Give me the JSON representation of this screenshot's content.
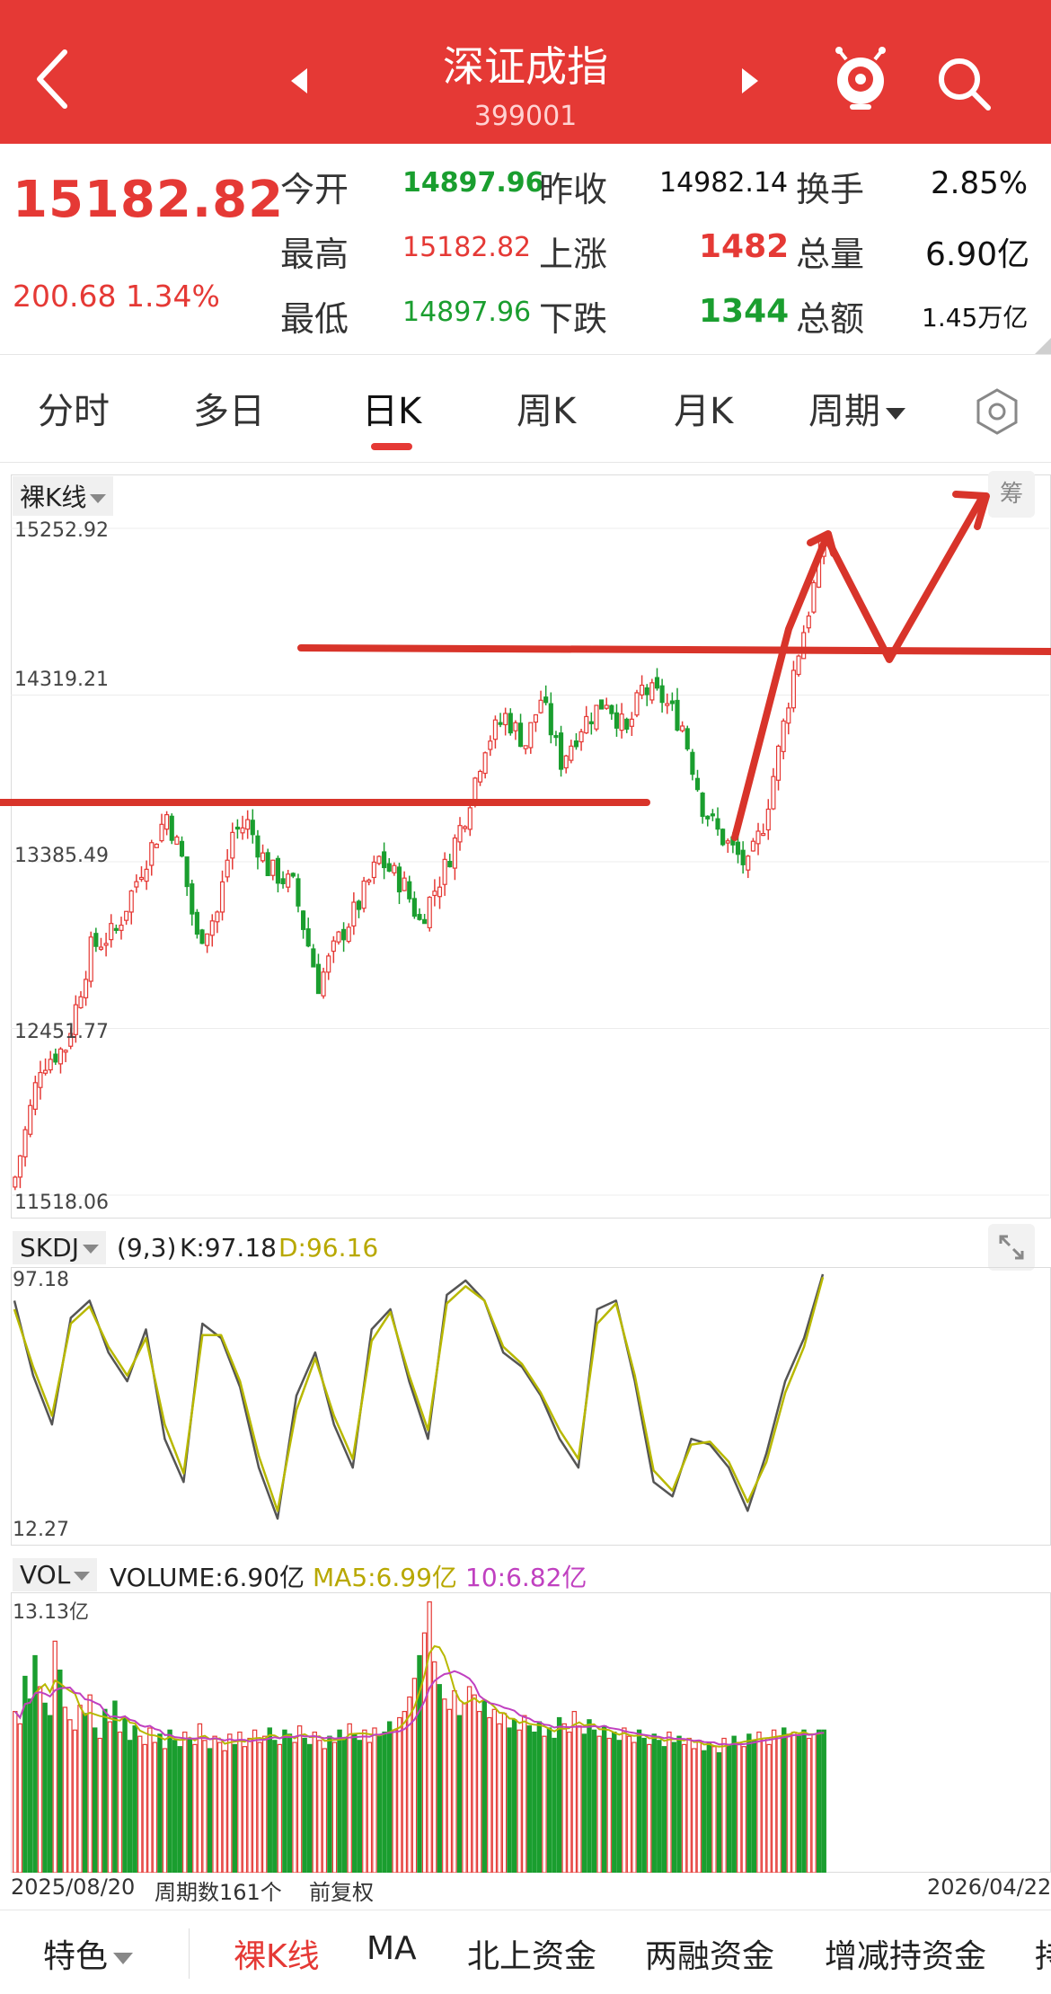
{
  "header": {
    "title": "深证成指",
    "code": "399001"
  },
  "quote": {
    "last_price": "15182.82",
    "change": "200.68",
    "change_pct": "1.34%",
    "fields": [
      {
        "label": "今开",
        "value": "14897.96",
        "color": "green"
      },
      {
        "label": "昨收",
        "value": "14982.14",
        "color": "dark"
      },
      {
        "label": "换手",
        "value": "2.85%",
        "color": "dark"
      },
      {
        "label": "最高",
        "value": "15182.82",
        "color": "red"
      },
      {
        "label": "上涨",
        "value": "1482",
        "color": "red"
      },
      {
        "label": "总量",
        "value": "6.90亿",
        "color": "dark"
      },
      {
        "label": "最低",
        "value": "14897.96",
        "color": "green"
      },
      {
        "label": "下跌",
        "value": "1344",
        "color": "green"
      },
      {
        "label": "总额",
        "value": "1.45万亿",
        "color": "dark"
      }
    ]
  },
  "tabs": [
    "分时",
    "多日",
    "日K",
    "周K",
    "月K",
    "周期"
  ],
  "active_tab": "日K",
  "kline": {
    "indicator": "裸K线",
    "chip_button": "筹",
    "price_labels": [
      "15252.92",
      "14319.21",
      "13385.49",
      "12451.77",
      "11518.06"
    ]
  },
  "skdj": {
    "indicator": "SKDJ",
    "params": "(9,3)",
    "k_text": "K:97.18",
    "d_text": "D:96.16",
    "top_label": "97.18",
    "bottom_label": "12.27"
  },
  "volume": {
    "indicator": "VOL",
    "volume_text": "VOLUME:6.90亿",
    "ma5_text": "MA5:6.99亿",
    "ma10_text": "10:6.82亿",
    "top_label": "13.13亿"
  },
  "dates": {
    "start": "2025/08/20",
    "period_count": "周期数161个",
    "adjust": "前复权",
    "end": "2026/04/22"
  },
  "bottom_tabs": [
    "特色",
    "裸K线",
    "MA",
    "北上资金",
    "两融资金",
    "增减持资金",
    "持"
  ],
  "colors": {
    "up": "#e53935",
    "down": "#1a9e2f",
    "header": "#e53935",
    "k_line": "#555555",
    "d_line": "#b8b800",
    "ma10": "#c040c0"
  },
  "chart_data": [
    {
      "type": "candlestick",
      "title": "",
      "ylim": [
        11518.06,
        15252.92
      ],
      "y_ticks": [
        15252.92,
        14319.21,
        13385.49,
        12451.77,
        11518.06
      ],
      "periods": 161,
      "x_range": [
        "2025/08/20",
        "2026/04/22"
      ],
      "close_path": [
        [
          0,
          11620
        ],
        [
          5,
          12250
        ],
        [
          10,
          12350
        ],
        [
          15,
          12900
        ],
        [
          20,
          13000
        ],
        [
          25,
          13350
        ],
        [
          30,
          13650
        ],
        [
          33,
          13400
        ],
        [
          36,
          12950
        ],
        [
          40,
          13100
        ],
        [
          43,
          13550
        ],
        [
          46,
          13600
        ],
        [
          50,
          13350
        ],
        [
          55,
          13250
        ],
        [
          60,
          12700
        ],
        [
          64,
          12950
        ],
        [
          68,
          13150
        ],
        [
          72,
          13400
        ],
        [
          77,
          13250
        ],
        [
          80,
          13050
        ],
        [
          85,
          13350
        ],
        [
          89,
          13650
        ],
        [
          93,
          14050
        ],
        [
          97,
          14200
        ],
        [
          101,
          14050
        ],
        [
          104,
          14300
        ],
        [
          108,
          13950
        ],
        [
          112,
          14150
        ],
        [
          117,
          14300
        ],
        [
          121,
          14100
        ],
        [
          124,
          14350
        ],
        [
          128,
          14300
        ],
        [
          132,
          14150
        ],
        [
          136,
          13700
        ],
        [
          139,
          13550
        ],
        [
          142,
          13450
        ],
        [
          145,
          13350
        ],
        [
          148,
          13600
        ],
        [
          151,
          14000
        ],
        [
          154,
          14450
        ],
        [
          157,
          14800
        ],
        [
          160,
          15180
        ]
      ],
      "annotations": "hand-drawn red horizontal lines near 13,750 and 14,540; red arrow up then down then up"
    },
    {
      "type": "line",
      "title": "SKDJ(9,3)",
      "ylim": [
        12.27,
        97.18
      ],
      "series": [
        {
          "name": "K",
          "values": [
            88,
            62,
            45,
            82,
            88,
            70,
            60,
            78,
            40,
            25,
            80,
            75,
            58,
            30,
            12,
            55,
            70,
            45,
            30,
            78,
            85,
            60,
            40,
            90,
            95,
            88,
            70,
            65,
            55,
            40,
            30,
            85,
            88,
            60,
            25,
            20,
            40,
            38,
            30,
            15,
            35,
            60,
            75,
            97.18
          ]
        },
        {
          "name": "D",
          "values": [
            85,
            65,
            48,
            80,
            86,
            72,
            62,
            75,
            45,
            28,
            76,
            76,
            60,
            34,
            15,
            50,
            68,
            48,
            33,
            74,
            84,
            62,
            43,
            87,
            93,
            88,
            72,
            66,
            56,
            43,
            33,
            80,
            87,
            62,
            29,
            22,
            38,
            39,
            32,
            18,
            32,
            56,
            72,
            96.16
          ]
        }
      ]
    },
    {
      "type": "bar",
      "title": "VOLUME",
      "ylim": [
        0,
        13.13
      ],
      "unit": "亿",
      "values": [
        7.8,
        7.2,
        9.5,
        8.4,
        10.5,
        9.0,
        8.2,
        7.6,
        11.2,
        9.8,
        8.0,
        7.4,
        6.9,
        8.1,
        7.7,
        8.6,
        7.0,
        6.5,
        7.9,
        7.3,
        8.3,
        6.8,
        7.5,
        6.4,
        7.1,
        6.6,
        6.2,
        7.0,
        6.3,
        6.7,
        6.0,
        6.9,
        6.4,
        6.1,
        6.8,
        6.5,
        6.2,
        7.2,
        6.4,
        6.0,
        6.6,
        6.3,
        5.9,
        6.7,
        6.2,
        6.8,
        6.1,
        6.5,
        6.9,
        6.3,
        6.6,
        7.0,
        6.4,
        6.2,
        6.9,
        6.7,
        6.3,
        7.1,
        6.5,
        6.2,
        6.8,
        6.4,
        6.0,
        6.6,
        6.3,
        6.9,
        6.5,
        7.2,
        6.7,
        6.4,
        6.9,
        6.3,
        7.0,
        6.6,
        6.8,
        7.3,
        6.9,
        7.5,
        7.8,
        8.5,
        9.4,
        10.5,
        11.6,
        13.1,
        10.2,
        9.1,
        8.4,
        7.9,
        8.8,
        7.6,
        8.2,
        9.0,
        8.6,
        7.8,
        8.3,
        7.5,
        7.9,
        7.2,
        7.7,
        7.0,
        7.4,
        6.9,
        7.6,
        7.1,
        6.8,
        7.3,
        6.6,
        7.0,
        6.5,
        7.5,
        7.2,
        6.8,
        7.8,
        7.1,
        6.7,
        7.4,
        6.9,
        6.6,
        7.1,
        6.5,
        6.8,
        6.4,
        7.0,
        6.6,
        6.3,
        6.9,
        6.5,
        6.2,
        6.7,
        6.4,
        6.1,
        6.8,
        6.3,
        6.6,
        6.2,
        6.5,
        6.0,
        6.4,
        5.9,
        6.3,
        6.1,
        5.8,
        6.5,
        6.2,
        6.6,
        6.3,
        6.1,
        6.7,
        6.4,
        6.8,
        6.5,
        6.2,
        6.9,
        6.6,
        7.0,
        6.7,
        6.8,
        6.6,
        6.9,
        6.5,
        6.7,
        6.9,
        6.9
      ]
    }
  ]
}
